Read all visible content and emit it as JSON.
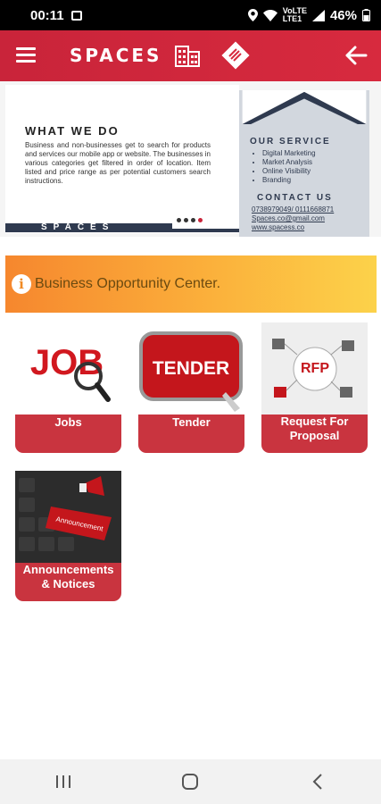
{
  "status_bar": {
    "time": "00:11",
    "network_label_top": "VoLTE",
    "network_label_bottom": "LTE1",
    "battery": "46%"
  },
  "app_bar": {
    "brand": "SPACES"
  },
  "banner": {
    "heading": "WHAT WE DO",
    "body": "Business and non-businesses get to search for products and services our mobile app or website. The businesses in various categories get filtered in order of location. Item listed and price range as per potential customers search instructions.",
    "strip_text": "SPACES",
    "service_title": "OUR SERVICE",
    "services": [
      "Digital Marketing",
      "Market Analysis",
      "Online Visibility",
      "Branding"
    ],
    "contact_title": "CONTACT US",
    "contacts": [
      "0738979049/ 0111668871",
      "Spaces.co@gmail.com",
      "www.spacess.co"
    ],
    "carousel_dots": 4,
    "active_dot": 3
  },
  "notice": {
    "icon": "info-icon",
    "text": "Business Opportunity Center."
  },
  "tiles": [
    {
      "label": "Jobs",
      "image_text": "JOB"
    },
    {
      "label": "Tender",
      "image_text": "TENDER"
    },
    {
      "label": "Request For Proposal",
      "label_line1": "Request For",
      "label_line2": "Proposal",
      "image_text": "RFP"
    },
    {
      "label": "Announcements & Notices",
      "label_line1": "Announcements",
      "label_line2": "& Notices",
      "image_text": "Announcement"
    }
  ],
  "colors": {
    "brand_red": "#c9243a",
    "tile_label": "#c9343f",
    "notice_start": "#f6872e",
    "notice_end": "#fcd24a"
  },
  "nav_bar": {
    "recents_icon": "recents-icon",
    "home_icon": "home-icon",
    "back_icon": "back-icon"
  }
}
